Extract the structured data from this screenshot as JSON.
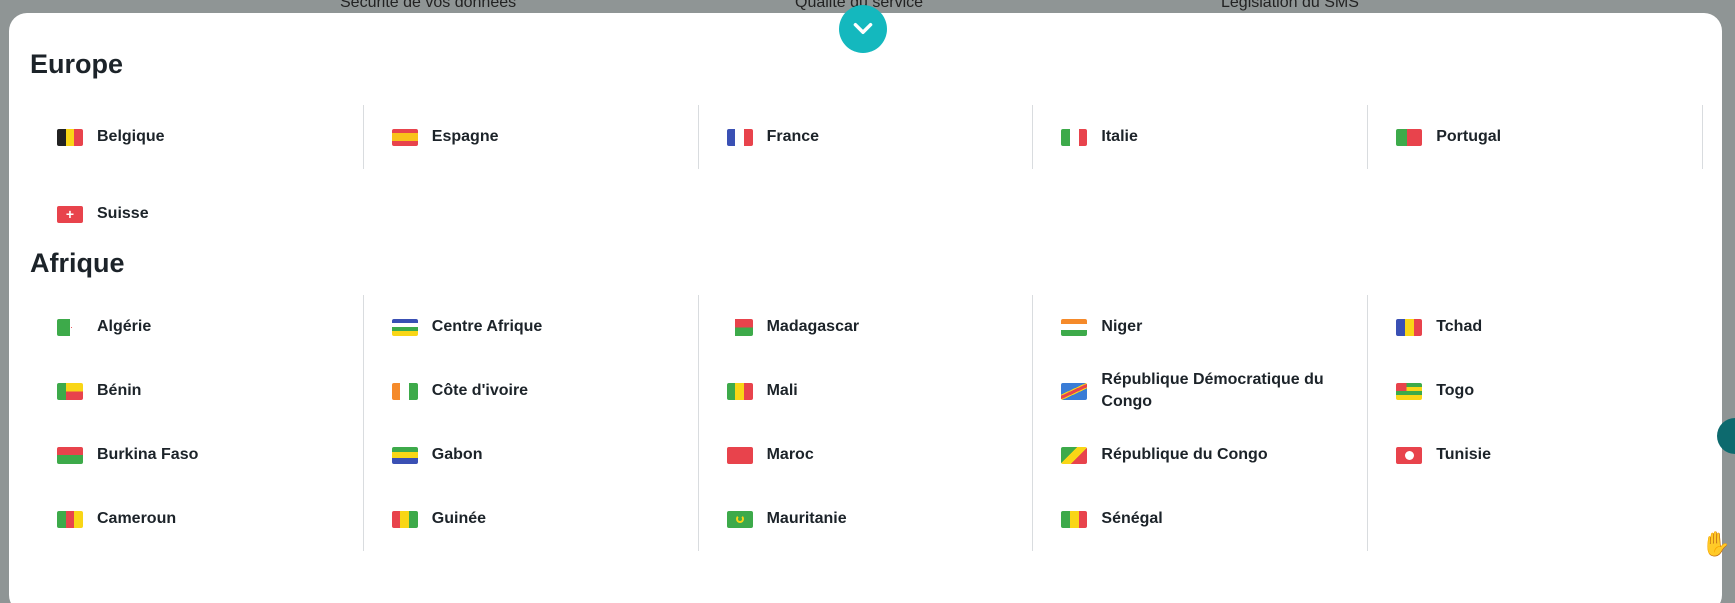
{
  "top_nav": {
    "items": [
      "Sécurité de vos données",
      "Qualité du service",
      "Législation du SMS"
    ]
  },
  "toggle": {
    "icon": "chevron-down-icon",
    "color": "#14b8be"
  },
  "sections": [
    {
      "title": "Europe",
      "countries": [
        {
          "label": "Belgique",
          "flag": "flag-belgium-icon"
        },
        {
          "label": "Espagne",
          "flag": "flag-spain-icon"
        },
        {
          "label": "France",
          "flag": "flag-france-icon"
        },
        {
          "label": "Italie",
          "flag": "flag-italy-icon"
        },
        {
          "label": "Portugal",
          "flag": "flag-portugal-icon"
        },
        {
          "label": "Suisse",
          "flag": "flag-switzerland-icon"
        }
      ]
    },
    {
      "title": "Afrique",
      "countries": [
        {
          "label": "Algérie",
          "flag": "flag-algeria-icon"
        },
        {
          "label": "Centre Afrique",
          "flag": "flag-central-african-republic-icon"
        },
        {
          "label": "Madagascar",
          "flag": "flag-madagascar-icon"
        },
        {
          "label": "Niger",
          "flag": "flag-niger-icon"
        },
        {
          "label": "Tchad",
          "flag": "flag-chad-icon"
        },
        {
          "label": "Bénin",
          "flag": "flag-benin-icon"
        },
        {
          "label": "Côte d'ivoire",
          "flag": "flag-ivory-coast-icon"
        },
        {
          "label": "Mali",
          "flag": "flag-mali-icon"
        },
        {
          "label": "République Démocratique du Congo",
          "flag": "flag-dr-congo-icon"
        },
        {
          "label": "Togo",
          "flag": "flag-togo-icon"
        },
        {
          "label": "Burkina Faso",
          "flag": "flag-burkina-faso-icon"
        },
        {
          "label": "Gabon",
          "flag": "flag-gabon-icon"
        },
        {
          "label": "Maroc",
          "flag": "flag-morocco-icon"
        },
        {
          "label": "République du Congo",
          "flag": "flag-congo-icon"
        },
        {
          "label": "Tunisie",
          "flag": "flag-tunisia-icon"
        },
        {
          "label": "Cameroun",
          "flag": "flag-cameroon-icon"
        },
        {
          "label": "Guinée",
          "flag": "flag-guinea-icon"
        },
        {
          "label": "Mauritanie",
          "flag": "flag-mauritania-icon"
        },
        {
          "label": "Sénégal",
          "flag": "flag-senegal-icon"
        }
      ]
    }
  ]
}
